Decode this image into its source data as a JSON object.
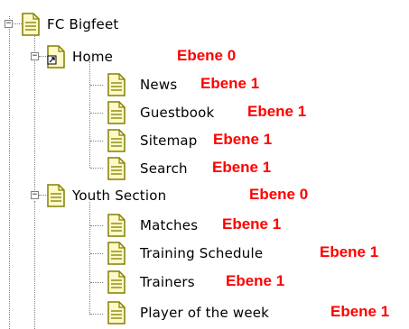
{
  "tree": {
    "root": {
      "label": "FC Bigfeet"
    },
    "groups": [
      {
        "label": "Home",
        "level": "Ebene 0",
        "children": [
          {
            "label": "News",
            "level": "Ebene 1"
          },
          {
            "label": "Guestbook",
            "level": "Ebene 1"
          },
          {
            "label": "Sitemap",
            "level": "Ebene 1"
          },
          {
            "label": "Search",
            "level": "Ebene 1"
          }
        ]
      },
      {
        "label": "Youth Section",
        "level": "Ebene 0",
        "children": [
          {
            "label": "Matches",
            "level": "Ebene 1"
          },
          {
            "label": "Training Schedule",
            "level": "Ebene 1"
          },
          {
            "label": "Trainers",
            "level": "Ebene 1"
          },
          {
            "label": "Player of the week",
            "level": "Ebene 1"
          }
        ]
      }
    ]
  },
  "colors": {
    "annotation": "#ff0000",
    "icon_fill": "#fff8c8",
    "icon_stroke": "#808000",
    "connector": "#808080"
  }
}
